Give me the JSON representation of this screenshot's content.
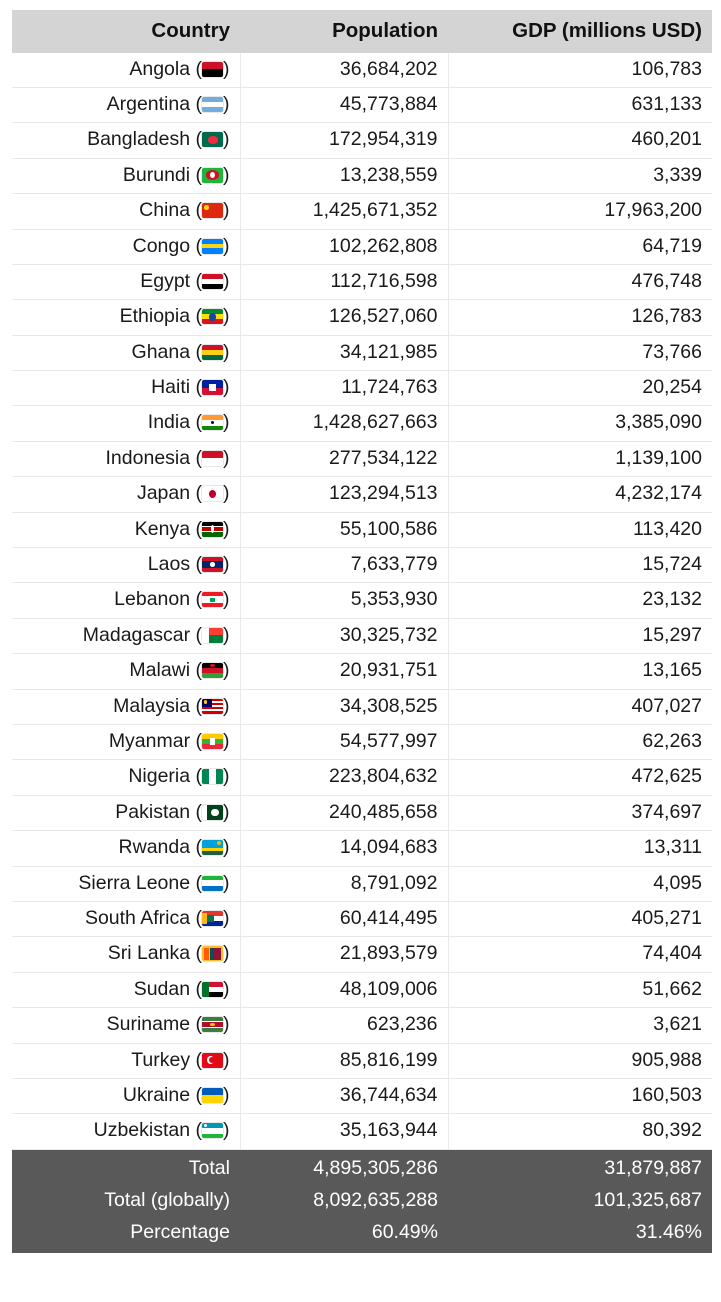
{
  "table": {
    "columns": [
      "Country",
      "Population",
      "GDP (millions USD)"
    ],
    "rows": [
      {
        "country": "Angola",
        "flag": "angola-flag",
        "population": "36,684,202",
        "gdp": "106,783"
      },
      {
        "country": "Argentina",
        "flag": "argentina-flag",
        "population": "45,773,884",
        "gdp": "631,133"
      },
      {
        "country": "Bangladesh",
        "flag": "bangladesh-flag",
        "population": "172,954,319",
        "gdp": "460,201"
      },
      {
        "country": "Burundi",
        "flag": "burundi-flag",
        "population": "13,238,559",
        "gdp": "3,339"
      },
      {
        "country": "China",
        "flag": "china-flag",
        "population": "1,425,671,352",
        "gdp": "17,963,200"
      },
      {
        "country": "Congo",
        "flag": "congo-flag",
        "population": "102,262,808",
        "gdp": "64,719"
      },
      {
        "country": "Egypt",
        "flag": "egypt-flag",
        "population": "112,716,598",
        "gdp": "476,748"
      },
      {
        "country": "Ethiopia",
        "flag": "ethiopia-flag",
        "population": "126,527,060",
        "gdp": "126,783"
      },
      {
        "country": "Ghana",
        "flag": "ghana-flag",
        "population": "34,121,985",
        "gdp": "73,766"
      },
      {
        "country": "Haiti",
        "flag": "haiti-flag",
        "population": "11,724,763",
        "gdp": "20,254"
      },
      {
        "country": "India",
        "flag": "india-flag",
        "population": "1,428,627,663",
        "gdp": "3,385,090"
      },
      {
        "country": "Indonesia",
        "flag": "indonesia-flag",
        "population": "277,534,122",
        "gdp": "1,139,100"
      },
      {
        "country": "Japan",
        "flag": "japan-flag",
        "population": "123,294,513",
        "gdp": "4,232,174"
      },
      {
        "country": "Kenya",
        "flag": "kenya-flag",
        "population": "55,100,586",
        "gdp": "113,420"
      },
      {
        "country": "Laos",
        "flag": "laos-flag",
        "population": "7,633,779",
        "gdp": "15,724"
      },
      {
        "country": "Lebanon",
        "flag": "lebanon-flag",
        "population": "5,353,930",
        "gdp": "23,132"
      },
      {
        "country": "Madagascar",
        "flag": "madagascar-flag",
        "population": "30,325,732",
        "gdp": "15,297"
      },
      {
        "country": "Malawi",
        "flag": "malawi-flag",
        "population": "20,931,751",
        "gdp": "13,165"
      },
      {
        "country": "Malaysia",
        "flag": "malaysia-flag",
        "population": "34,308,525",
        "gdp": "407,027"
      },
      {
        "country": "Myanmar",
        "flag": "myanmar-flag",
        "population": "54,577,997",
        "gdp": "62,263"
      },
      {
        "country": "Nigeria",
        "flag": "nigeria-flag",
        "population": "223,804,632",
        "gdp": "472,625"
      },
      {
        "country": "Pakistan",
        "flag": "pakistan-flag",
        "population": "240,485,658",
        "gdp": "374,697"
      },
      {
        "country": "Rwanda",
        "flag": "rwanda-flag",
        "population": "14,094,683",
        "gdp": "13,311"
      },
      {
        "country": "Sierra Leone",
        "flag": "sierra-leone-flag",
        "population": "8,791,092",
        "gdp": "4,095"
      },
      {
        "country": "South Africa",
        "flag": "south-africa-flag",
        "population": "60,414,495",
        "gdp": "405,271"
      },
      {
        "country": "Sri Lanka",
        "flag": "sri-lanka-flag",
        "population": "21,893,579",
        "gdp": "74,404"
      },
      {
        "country": "Sudan",
        "flag": "sudan-flag",
        "population": "48,109,006",
        "gdp": "51,662"
      },
      {
        "country": "Suriname",
        "flag": "suriname-flag",
        "population": "623,236",
        "gdp": "3,621"
      },
      {
        "country": "Turkey",
        "flag": "turkey-flag",
        "population": "85,816,199",
        "gdp": "905,988"
      },
      {
        "country": "Ukraine",
        "flag": "ukraine-flag",
        "population": "36,744,634",
        "gdp": "160,503"
      },
      {
        "country": "Uzbekistan",
        "flag": "uzbekistan-flag",
        "population": "35,163,944",
        "gdp": "80,392"
      }
    ],
    "footer_rows": [
      {
        "label": "Total",
        "population": "4,895,305,286",
        "gdp": "31,879,887"
      },
      {
        "label": "Total (globally)",
        "population": "8,092,635,288",
        "gdp": "101,325,687"
      },
      {
        "label": "Percentage",
        "population": "60.49%",
        "gdp": "31.46%"
      }
    ]
  },
  "colors": {
    "header_bg": "#d4d4d4",
    "footer_bg": "#595959",
    "body_bg": "#ffffff",
    "text": "#1a1a1a",
    "footer_text": "#ffffff"
  }
}
